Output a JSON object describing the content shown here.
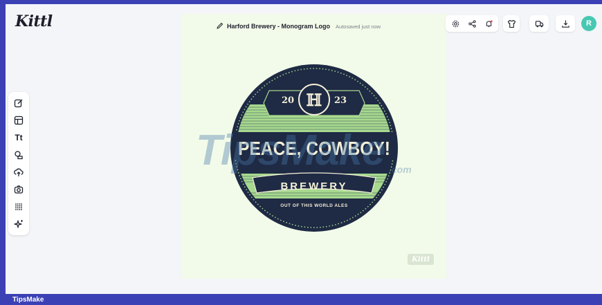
{
  "app": {
    "logo": "Kittl"
  },
  "document": {
    "title": "Harford Brewery - Monogram Logo",
    "autosave_status": "Autosaved just now"
  },
  "toolbar": {
    "tools": [
      {
        "name": "edit",
        "icon": "edit-icon"
      },
      {
        "name": "templates",
        "icon": "layout-icon"
      },
      {
        "name": "text",
        "icon": "text-icon",
        "label": "Tt"
      },
      {
        "name": "elements",
        "icon": "shapes-icon"
      },
      {
        "name": "uploads",
        "icon": "upload-cloud-icon"
      },
      {
        "name": "photos",
        "icon": "camera-icon"
      },
      {
        "name": "patterns",
        "icon": "grid-dots-icon"
      },
      {
        "name": "ai",
        "icon": "sparkle-icon"
      }
    ]
  },
  "top_actions": {
    "icons": [
      "settings-icon",
      "share-icon",
      "notification-icon",
      "tshirt-icon",
      "truck-icon",
      "download-icon"
    ],
    "avatar_initial": "R",
    "accent": "#48c8b3"
  },
  "artwork": {
    "year_left": "20",
    "year_right": "23",
    "headline": "PEACE, COWBOY!",
    "subhead": "BREWERY",
    "tagline": "OUT OF THIS WORLD ALES",
    "colors": {
      "navy": "#1f2a44",
      "green": "#a7d98f",
      "cream": "#f4f0d8"
    }
  },
  "overlay": {
    "watermark": "TipsMake",
    "watermark_suffix": ".com",
    "stamp": "Kittl"
  },
  "footer": {
    "label": "TipsMake"
  }
}
